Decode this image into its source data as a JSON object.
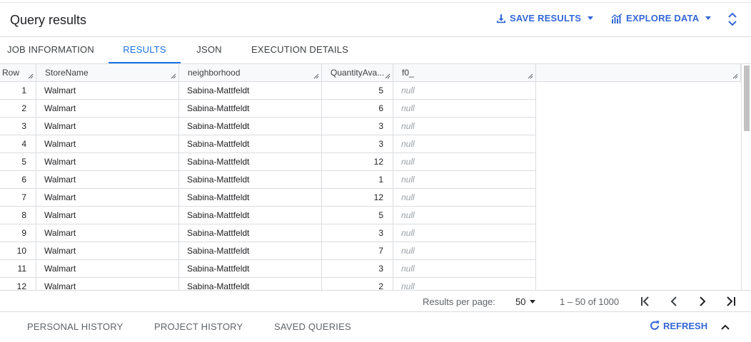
{
  "header": {
    "title": "Query results",
    "save_results": "SAVE RESULTS",
    "explore_data": "EXPLORE DATA"
  },
  "tabs": [
    {
      "label": "JOB INFORMATION"
    },
    {
      "label": "RESULTS",
      "active": true
    },
    {
      "label": "JSON"
    },
    {
      "label": "EXECUTION DETAILS"
    }
  ],
  "table": {
    "columns": [
      "Row",
      "StoreName",
      "neighborhood",
      "QuantityAva...",
      "f0_"
    ],
    "rows": [
      {
        "row": "1",
        "store": "Walmart",
        "neighborhood": "Sabina-Mattfeldt",
        "qty": "5",
        "f0": "null"
      },
      {
        "row": "2",
        "store": "Walmart",
        "neighborhood": "Sabina-Mattfeldt",
        "qty": "6",
        "f0": "null"
      },
      {
        "row": "3",
        "store": "Walmart",
        "neighborhood": "Sabina-Mattfeldt",
        "qty": "3",
        "f0": "null"
      },
      {
        "row": "4",
        "store": "Walmart",
        "neighborhood": "Sabina-Mattfeldt",
        "qty": "3",
        "f0": "null"
      },
      {
        "row": "5",
        "store": "Walmart",
        "neighborhood": "Sabina-Mattfeldt",
        "qty": "12",
        "f0": "null"
      },
      {
        "row": "6",
        "store": "Walmart",
        "neighborhood": "Sabina-Mattfeldt",
        "qty": "1",
        "f0": "null"
      },
      {
        "row": "7",
        "store": "Walmart",
        "neighborhood": "Sabina-Mattfeldt",
        "qty": "12",
        "f0": "null"
      },
      {
        "row": "8",
        "store": "Walmart",
        "neighborhood": "Sabina-Mattfeldt",
        "qty": "5",
        "f0": "null"
      },
      {
        "row": "9",
        "store": "Walmart",
        "neighborhood": "Sabina-Mattfeldt",
        "qty": "3",
        "f0": "null"
      },
      {
        "row": "10",
        "store": "Walmart",
        "neighborhood": "Sabina-Mattfeldt",
        "qty": "7",
        "f0": "null"
      },
      {
        "row": "11",
        "store": "Walmart",
        "neighborhood": "Sabina-Mattfeldt",
        "qty": "3",
        "f0": "null"
      },
      {
        "row": "12",
        "store": "Walmart",
        "neighborhood": "Sabina-Mattfeldt",
        "qty": "2",
        "f0": "null"
      }
    ]
  },
  "pagination": {
    "per_page_label": "Results per page:",
    "per_page_value": "50",
    "range": "1 – 50 of 1000"
  },
  "bottom": {
    "tabs": [
      "PERSONAL HISTORY",
      "PROJECT HISTORY",
      "SAVED QUERIES"
    ],
    "refresh": "REFRESH"
  },
  "icons": {
    "save": "download-icon",
    "explore": "chart-icon",
    "expand": "unfold-icon",
    "refresh": "refresh-icon",
    "collapse": "chevron-up-icon"
  },
  "colors": {
    "accent": "#1a73e8",
    "action": "#3367d6"
  }
}
